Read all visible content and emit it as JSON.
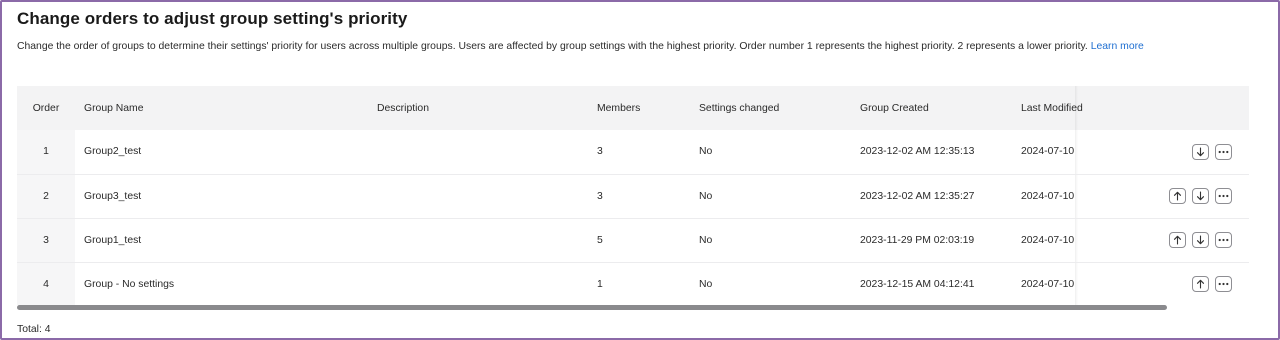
{
  "header": {
    "title": "Change orders to adjust group setting's priority",
    "description": "Change the order of groups to determine their settings' priority for users across multiple groups. Users are affected by group settings with the highest priority. Order number 1 represents the highest priority. 2 represents a lower priority.",
    "learn_more": "Learn more"
  },
  "table": {
    "columns": {
      "order": "Order",
      "group_name": "Group Name",
      "description": "Description",
      "members": "Members",
      "settings_changed": "Settings changed",
      "group_created": "Group Created",
      "last_modified": "Last Modified"
    },
    "rows": [
      {
        "order": "1",
        "group_name": "Group2_test",
        "description": "",
        "members": "3",
        "settings_changed": "No",
        "group_created": "2023-12-02 AM 12:35:13",
        "last_modified": "2024-07-10",
        "actions": [
          "move-down-icon",
          "more-icon"
        ]
      },
      {
        "order": "2",
        "group_name": "Group3_test",
        "description": "",
        "members": "3",
        "settings_changed": "No",
        "group_created": "2023-12-02 AM 12:35:27",
        "last_modified": "2024-07-10",
        "actions": [
          "move-up-icon",
          "move-down-icon",
          "more-icon"
        ]
      },
      {
        "order": "3",
        "group_name": "Group1_test",
        "description": "",
        "members": "5",
        "settings_changed": "No",
        "group_created": "2023-11-29 PM 02:03:19",
        "last_modified": "2024-07-10",
        "actions": [
          "move-up-icon",
          "move-down-icon",
          "more-icon"
        ]
      },
      {
        "order": "4",
        "group_name": "Group - No settings",
        "description": "",
        "members": "1",
        "settings_changed": "No",
        "group_created": "2023-12-15 AM 04:12:41",
        "last_modified": "2024-07-10",
        "actions": [
          "move-up-icon",
          "more-icon"
        ]
      }
    ]
  },
  "footer": {
    "total": "Total: 4"
  },
  "colors": {
    "frame_border": "#8b6aa8",
    "link": "#1f6fd1",
    "header_bg": "#f3f3f4",
    "scrollbar": "#8a8a8d"
  }
}
